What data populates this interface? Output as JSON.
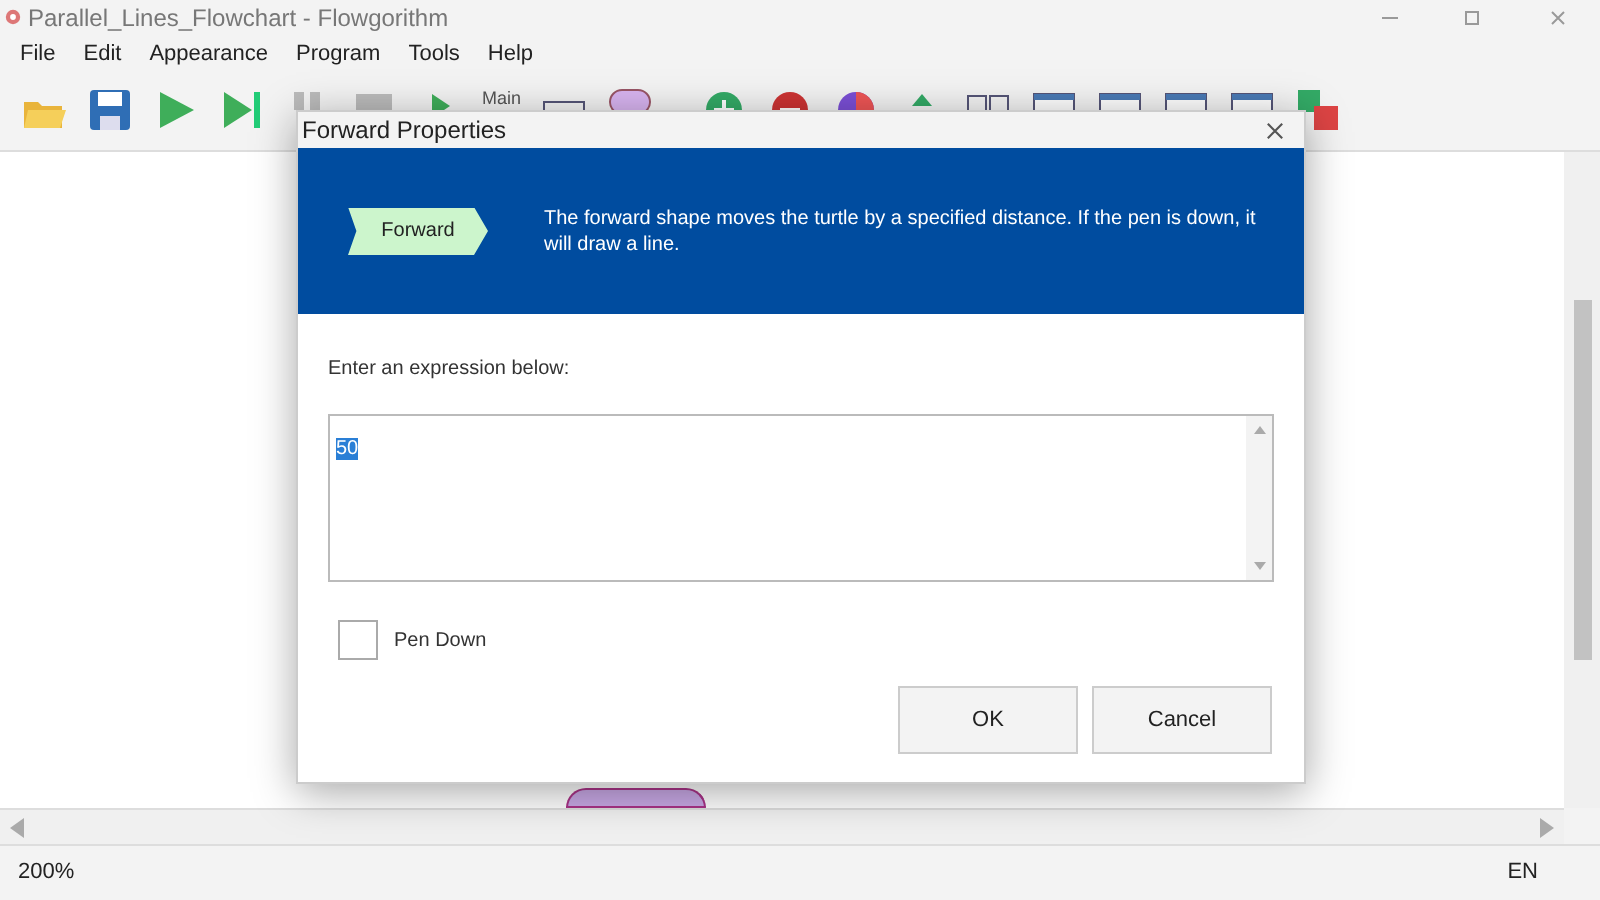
{
  "window": {
    "title": "Parallel_Lines_Flowchart - Flowgorithm"
  },
  "menu": [
    "File",
    "Edit",
    "Appearance",
    "Program",
    "Tools",
    "Help"
  ],
  "toolbar": {
    "function_label": "Main"
  },
  "dialog": {
    "title": "Forward Properties",
    "shape_label": "Forward",
    "description": "The forward shape moves the turtle by a specified distance. If the pen is down, it will draw a line.",
    "prompt": "Enter an expression below:",
    "expression": "50",
    "pen_down": {
      "label": "Pen Down",
      "checked": false
    },
    "buttons": [
      "OK",
      "Cancel"
    ]
  },
  "status_bar": {
    "zoom": "200%",
    "language": "EN"
  }
}
